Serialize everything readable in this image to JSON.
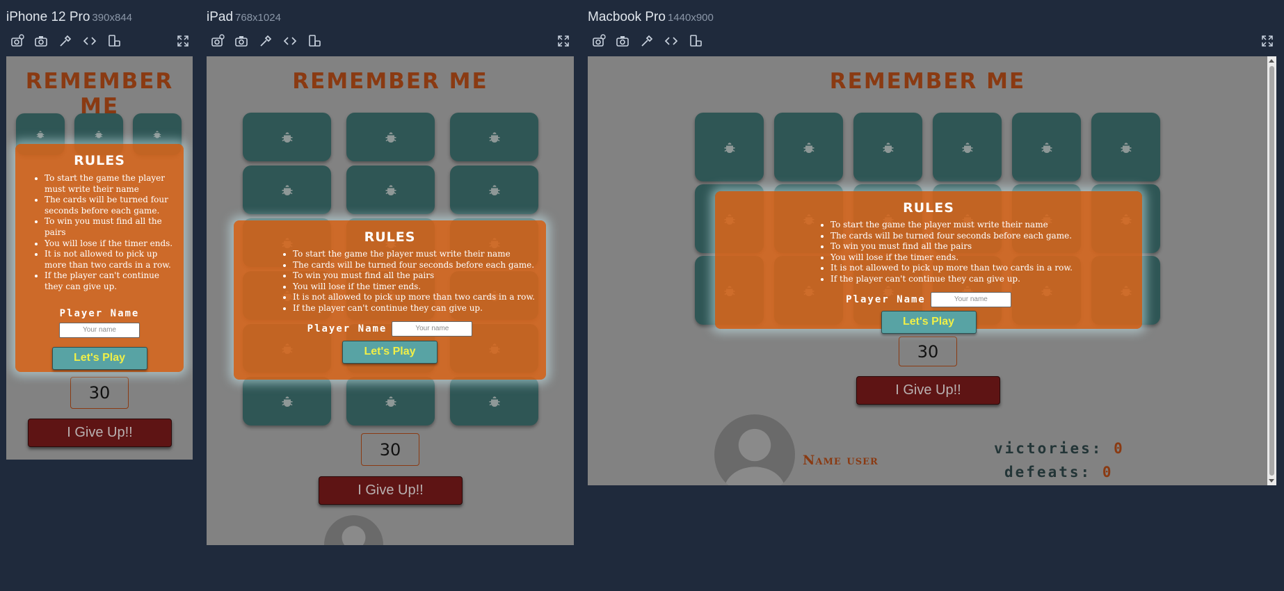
{
  "devices": [
    {
      "name": "iPhone 12 Pro",
      "dims": "390x844"
    },
    {
      "name": "iPad",
      "dims": "768x1024"
    },
    {
      "name": "Macbook Pro",
      "dims": "1440x900"
    }
  ],
  "toolbar_icons": [
    "camera-timer-icon",
    "camera-icon",
    "color-picker-icon",
    "code-icon",
    "rotate-icon",
    "fullscreen-icon"
  ],
  "app": {
    "title": "REMEMBER ME",
    "card_icon": "bug-icon",
    "timer": "30",
    "give_up": "I Give Up!!",
    "user_name": "Name user",
    "victories_label": "victories:",
    "victories_value": "0",
    "defeats_label": "defeats:",
    "defeats_value": "0"
  },
  "modal": {
    "title": "RULES",
    "rules": [
      "To start the game the player must write their name",
      "The cards will be turned four seconds before each game.",
      "To win you must find all the pairs",
      "You will lose if the timer ends.",
      "It is not allowed to pick up more than two cards in a row.",
      "If the player can't continue they can give up."
    ],
    "player_label": "Player Name",
    "player_placeholder": "Your name",
    "play_button": "Let's Play"
  },
  "colors": {
    "background": "#1f2a3c",
    "card": "#2f5655",
    "modal": "#d7661c",
    "title": "#8a3a12",
    "give_up": "#5e1414",
    "play_button": "#58a3a4",
    "play_text": "#f0ef47"
  }
}
